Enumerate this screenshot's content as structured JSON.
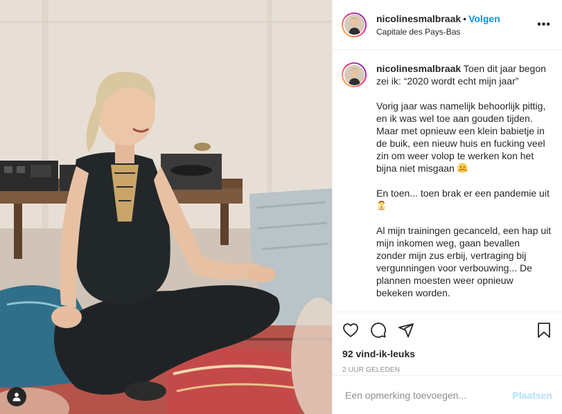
{
  "post": {
    "username": "nicolinesmalbraak",
    "separator": "•",
    "follow_label": "Volgen",
    "location": "Capitale des Pays-Bas",
    "more_icon": "more-options-icon",
    "more_glyph": "•••"
  },
  "caption": {
    "username": "nicolinesmalbraak",
    "paragraphs": [
      " Toen dit jaar begon zei ik: “2020 wordt echt mijn jaar”",
      "Vorig jaar was namelijk behoorlijk pittig, en ik was wel toe aan gouden tijden. Maar met opnieuw een klein babietje in de buik, een nieuw huis en fucking veel zin om weer volop te werken kon het bijna niet misgaan",
      "En toen... toen brak er een pandemie uit",
      "Al mijn trainingen gecanceld, een hap uit mijn inkomen weg, gaan bevallen zonder mijn zus erbij, vertraging bij vergunningen voor verbouwing... De plannen moesten weer opnieuw bekeken worden."
    ],
    "emojis": [
      "hugging-face-emoji",
      "woman-gesturing-no-emoji"
    ]
  },
  "actions": {
    "icons": [
      "heart-icon",
      "comment-icon",
      "share-icon",
      "bookmark-icon"
    ],
    "likes_text": "92 vind-ik-leuks",
    "timestamp": "2 UUR GELEDEN"
  },
  "comment": {
    "placeholder": "Een opmerking toevoegen...",
    "post_label": "Plaatsen"
  },
  "photo": {
    "user_tags_icon": "user-icon"
  },
  "colors": {
    "accent": "#0095f6",
    "text": "#262626",
    "muted": "#8e8e8e",
    "border": "#efefef",
    "post_disabled": "#b2dffc",
    "story_ring": [
      "#f9ce34",
      "#ee2a7b",
      "#6228d7"
    ]
  }
}
